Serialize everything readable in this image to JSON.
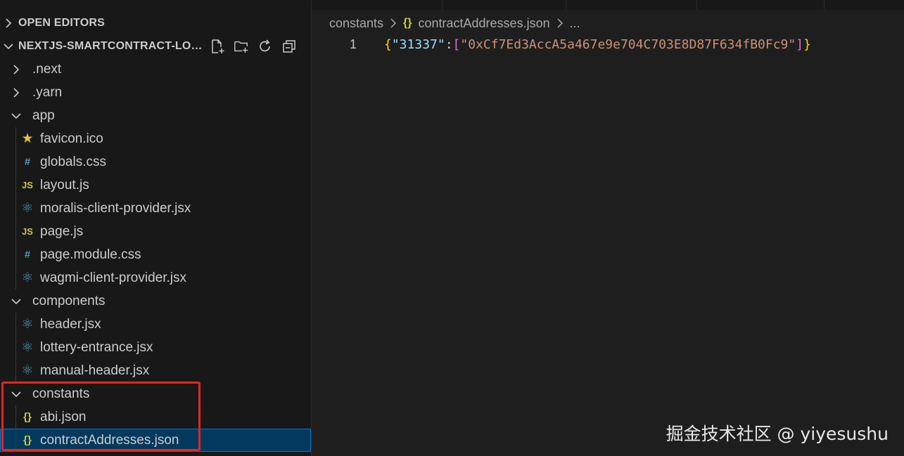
{
  "explorer": {
    "open_editors_title": "OPEN EDITORS",
    "workspace_title": "NEXTJS-SMARTCONTRACT-LOT...",
    "actions": [
      "new-file-icon",
      "new-folder-icon",
      "refresh-icon",
      "collapse-all-icon"
    ],
    "tree": [
      {
        "label": ".next",
        "kind": "folder",
        "expanded": false,
        "level": 0
      },
      {
        "label": ".yarn",
        "kind": "folder",
        "expanded": false,
        "level": 0
      },
      {
        "label": "app",
        "kind": "folder",
        "expanded": true,
        "level": 0
      },
      {
        "label": "favicon.ico",
        "kind": "file",
        "icon": "★",
        "icon_name": "star-icon",
        "icon_color": "#e5c03b",
        "level": 1
      },
      {
        "label": "globals.css",
        "kind": "file",
        "icon": "#",
        "icon_name": "css-icon",
        "icon_color": "#519aba",
        "level": 1
      },
      {
        "label": "layout.js",
        "kind": "file",
        "icon": "JS",
        "icon_name": "js-icon",
        "icon_color": "#cbcb41",
        "level": 1
      },
      {
        "label": "moralis-client-provider.jsx",
        "kind": "file",
        "icon": "⚛",
        "icon_name": "react-icon",
        "icon_color": "#519aba",
        "level": 1
      },
      {
        "label": "page.js",
        "kind": "file",
        "icon": "JS",
        "icon_name": "js-icon",
        "icon_color": "#cbcb41",
        "level": 1
      },
      {
        "label": "page.module.css",
        "kind": "file",
        "icon": "#",
        "icon_name": "css-icon",
        "icon_color": "#519aba",
        "level": 1
      },
      {
        "label": "wagmi-client-provider.jsx",
        "kind": "file",
        "icon": "⚛",
        "icon_name": "react-icon",
        "icon_color": "#519aba",
        "level": 1
      },
      {
        "label": "components",
        "kind": "folder",
        "expanded": true,
        "level": 0
      },
      {
        "label": "header.jsx",
        "kind": "file",
        "icon": "⚛",
        "icon_name": "react-icon",
        "icon_color": "#519aba",
        "level": 1
      },
      {
        "label": "lottery-entrance.jsx",
        "kind": "file",
        "icon": "⚛",
        "icon_name": "react-icon",
        "icon_color": "#519aba",
        "level": 1
      },
      {
        "label": "manual-header.jsx",
        "kind": "file",
        "icon": "⚛",
        "icon_name": "react-icon",
        "icon_color": "#519aba",
        "level": 1
      },
      {
        "label": "constants",
        "kind": "folder",
        "expanded": true,
        "level": 0
      },
      {
        "label": "abi.json",
        "kind": "file",
        "icon": "{}",
        "icon_name": "json-icon",
        "icon_color": "#cbcb41",
        "level": 1
      },
      {
        "label": "contractAddresses.json",
        "kind": "file",
        "icon": "{}",
        "icon_name": "json-icon",
        "icon_color": "#cbcb41",
        "level": 1,
        "selected": true
      }
    ]
  },
  "editor": {
    "breadcrumb": {
      "folder": "constants",
      "file_icon": "{}",
      "file": "contractAddresses.json",
      "more": "..."
    },
    "line_number": "1",
    "code": {
      "open_brace": "{",
      "key": "\"31337\"",
      "colon": ":",
      "open_bracket": "[",
      "value": "\"0xCf7Ed3AccA5a467e9e704C703E8D87F634fB0Fc9\"",
      "close_bracket": "]",
      "close_brace": "}"
    }
  },
  "watermark": "掘金技术社区 @ yiyesushu"
}
